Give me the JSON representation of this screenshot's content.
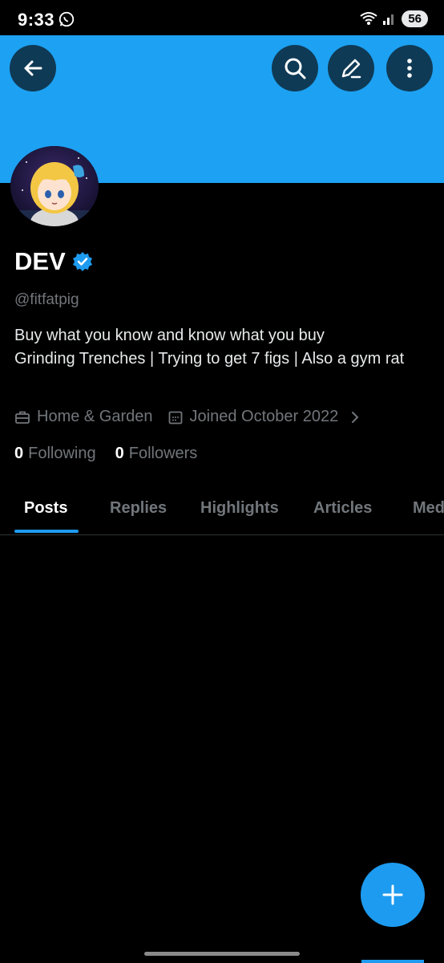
{
  "status_bar": {
    "time": "9:33",
    "battery": "56"
  },
  "profile": {
    "display_name": "DEV",
    "handle": "@fitfatpig",
    "bio": "Buy what you know and know what you buy\nGrinding Trenches | Trying to get 7 figs | Also a gym rat",
    "category": "Home & Garden",
    "joined": "Joined October 2022",
    "following_count": "0",
    "following_label": "Following",
    "followers_count": "0",
    "followers_label": "Followers"
  },
  "tabs": [
    {
      "label": "Posts"
    },
    {
      "label": "Replies"
    },
    {
      "label": "Highlights"
    },
    {
      "label": "Articles"
    },
    {
      "label": "Media"
    }
  ],
  "colors": {
    "banner": "#1da1f2",
    "accent": "#1d9bf0",
    "background": "#000000"
  },
  "icons": {
    "back": "arrow-left-icon",
    "search": "search-icon",
    "edit": "pencil-icon",
    "more": "more-vertical-icon",
    "compose": "plus-icon",
    "verified": "verified-badge-icon"
  }
}
